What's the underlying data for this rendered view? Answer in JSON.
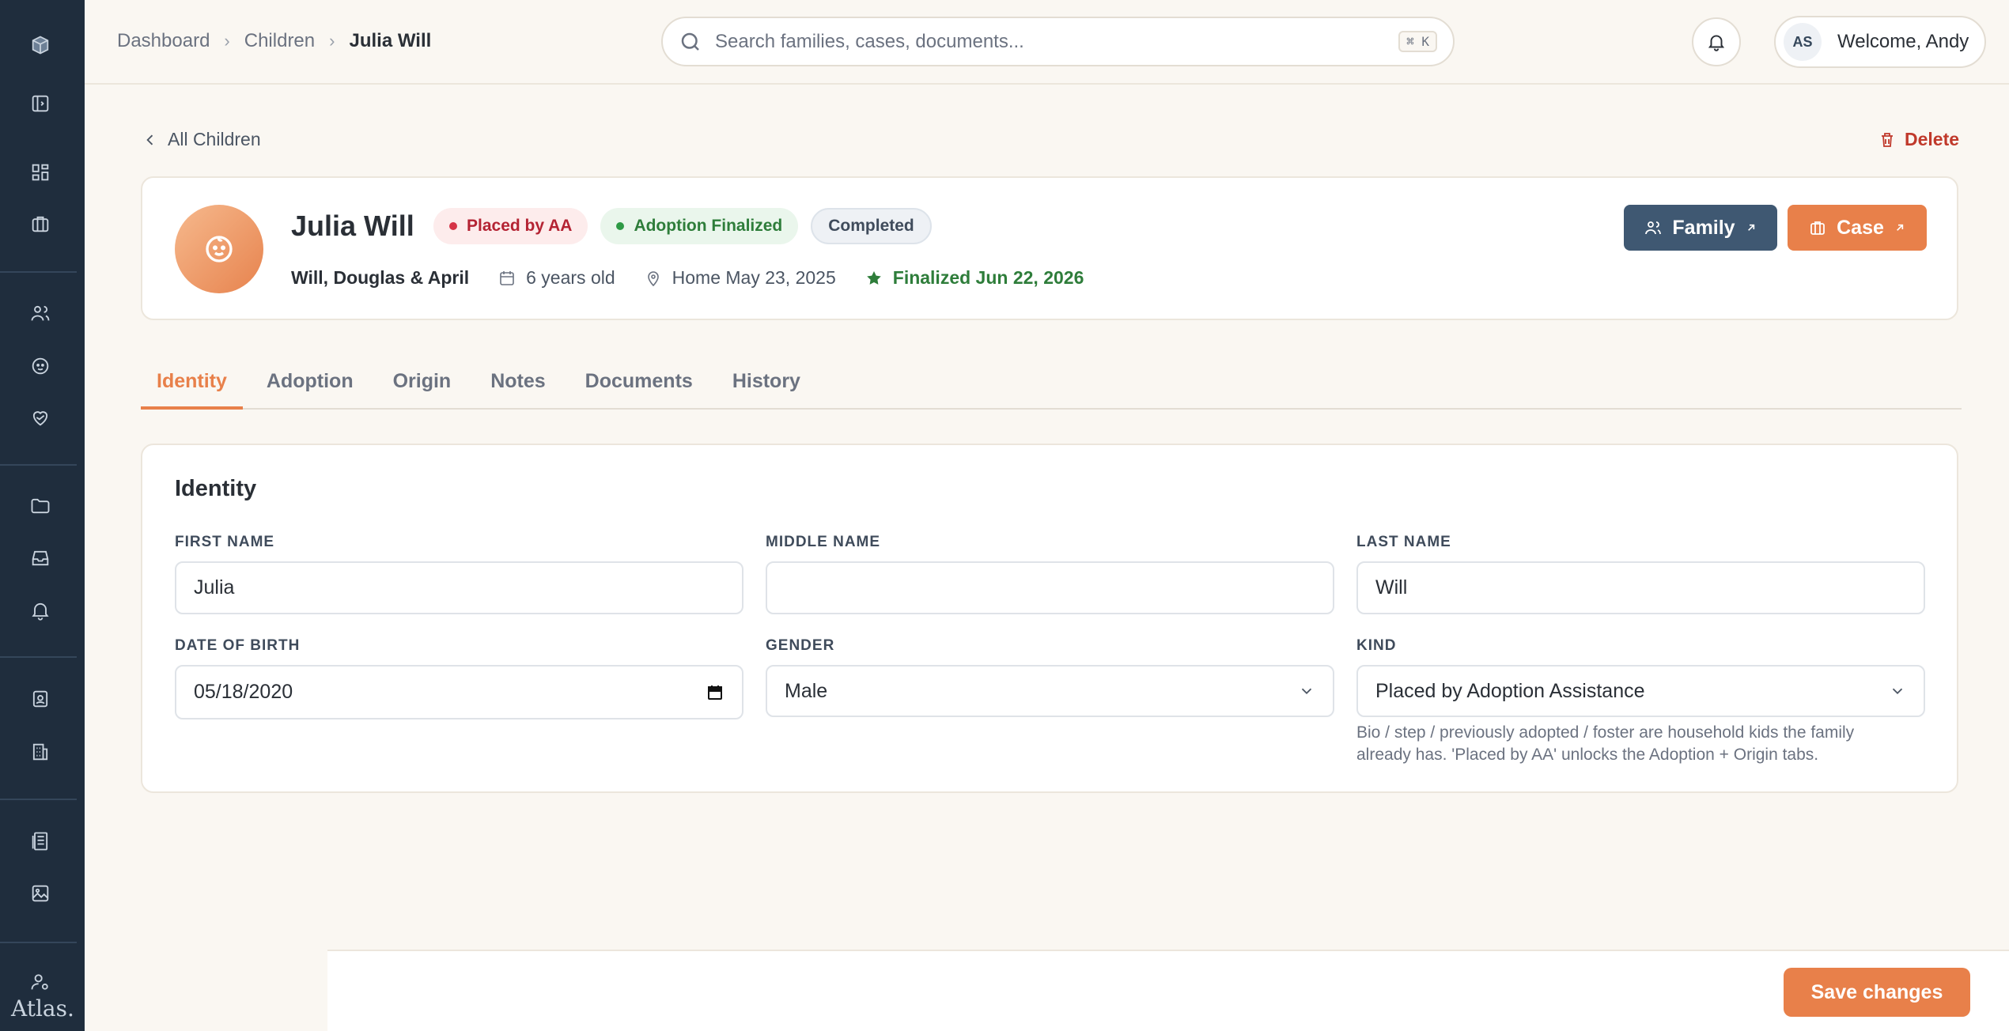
{
  "app": {
    "logo_text": "Atlas."
  },
  "breadcrumb": {
    "items": [
      "Dashboard",
      "Children",
      "Julia Will"
    ]
  },
  "search": {
    "placeholder": "Search families, cases, documents...",
    "shortcut": "⌘ K"
  },
  "user": {
    "initials": "AS",
    "welcome": "Welcome, Andy"
  },
  "nav": {
    "back_label": "All Children",
    "delete_label": "Delete"
  },
  "child": {
    "name": "Julia Will",
    "badges": [
      {
        "label": "Placed by AA",
        "color": "#b42333"
      },
      {
        "label": "Adoption Finalized",
        "color": "#2e7d3a"
      },
      {
        "label": "Completed",
        "color": "#3f4b5b"
      }
    ],
    "family_names": "Will, Douglas & April",
    "age": "6 years old",
    "home": "Home May 23, 2025",
    "finalized": "Finalized Jun 22, 2026"
  },
  "actions": {
    "family_label": "Family",
    "case_label": "Case"
  },
  "tabs": [
    {
      "label": "Identity",
      "active": true
    },
    {
      "label": "Adoption",
      "active": false
    },
    {
      "label": "Origin",
      "active": false
    },
    {
      "label": "Notes",
      "active": false
    },
    {
      "label": "Documents",
      "active": false
    },
    {
      "label": "History",
      "active": false
    }
  ],
  "identity": {
    "title": "Identity",
    "first_name": {
      "label": "FIRST NAME",
      "value": "Julia"
    },
    "middle_name": {
      "label": "MIDDLE NAME",
      "value": ""
    },
    "last_name": {
      "label": "LAST NAME",
      "value": "Will"
    },
    "dob": {
      "label": "DATE OF BIRTH",
      "value": "05/18/2020"
    },
    "gender": {
      "label": "GENDER",
      "value": "Male"
    },
    "kind": {
      "label": "KIND",
      "value": "Placed by Adoption Assistance"
    },
    "kind_help": "Bio / step / previously adopted / foster are household kids the family already has. 'Placed by AA' unlocks the Adoption + Origin tabs."
  },
  "footer": {
    "save_label": "Save changes"
  },
  "colors": {
    "accent": "#e8804a",
    "sidebar": "#1f2d3d",
    "family_button": "#3f5872"
  }
}
